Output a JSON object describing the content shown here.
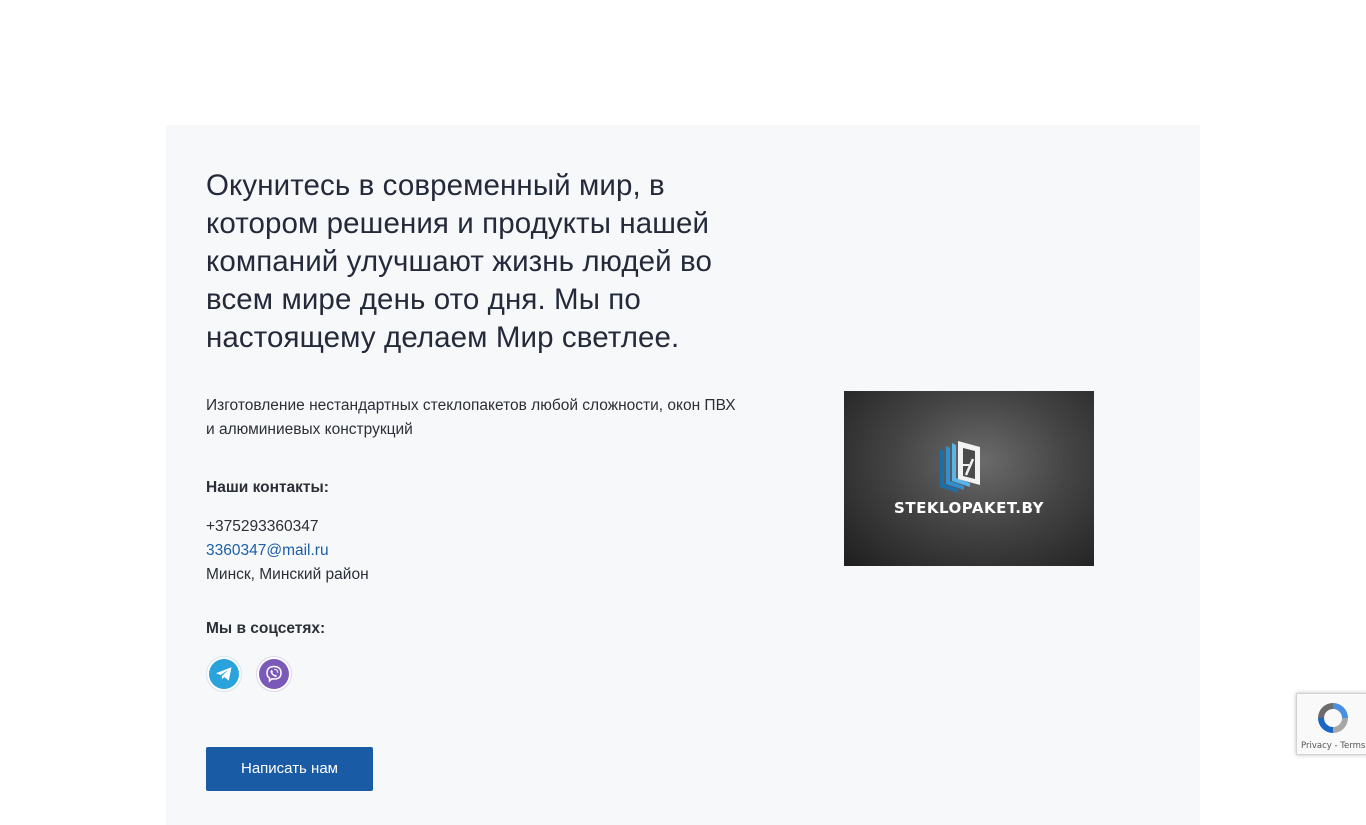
{
  "hero": {
    "headline": "Окунитесь в современный мир, в котором решения и продукты нашей компаний улучшают жизнь людей во всем мире день ото дня. Мы по настоящему делаем Мир светлее.",
    "description": "Изготовление нестандартных стеклопакетов любой сложности, окон ПВХ и алюминиевых конструкций"
  },
  "contacts": {
    "label": "Наши контакты:",
    "phone": "+375293360347",
    "email": "3360347@mail.ru",
    "address": "Минск, Минский район"
  },
  "social": {
    "label": "Мы в соцсетях:",
    "items": [
      {
        "name": "telegram",
        "icon": "telegram-icon",
        "color": "#2aa3dc"
      },
      {
        "name": "viber",
        "icon": "viber-icon",
        "color": "#7b59b9"
      }
    ]
  },
  "cta": {
    "label": "Написать нам"
  },
  "logo": {
    "brand": "STEKLOPAKET.BY"
  },
  "recaptcha": {
    "terms": "Privacy - Terms"
  },
  "colors": {
    "accent": "#1a5ba6",
    "link": "#1c5fa8",
    "card_background": "#f7f8fa"
  }
}
